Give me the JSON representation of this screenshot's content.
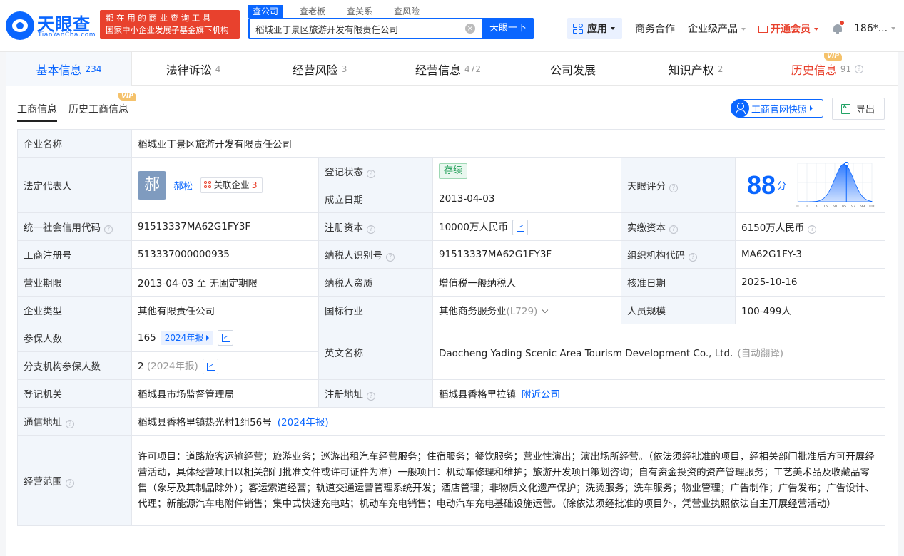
{
  "header": {
    "logo_cn": "天眼查",
    "logo_en": "TianYanCha.com",
    "banner_line1": "都在用的商业查询工具",
    "banner_line2": "国家中小企业发展子基金旗下机构",
    "search_tabs": [
      "查公司",
      "查老板",
      "查关系",
      "查风险"
    ],
    "search_value": "稻城亚丁景区旅游开发有限责任公司",
    "clear_glyph": "×",
    "search_button": "天眼一下",
    "apps_label": "应用",
    "business_coop": "商务合作",
    "enterprise_products": "企业级产品",
    "vip_label": "开通会员",
    "user": "186*..."
  },
  "tabs": [
    {
      "label": "基本信息",
      "count": "234"
    },
    {
      "label": "法律诉讼",
      "count": "4"
    },
    {
      "label": "经营风险",
      "count": "3"
    },
    {
      "label": "经营信息",
      "count": "472"
    },
    {
      "label": "公司发展",
      "count": ""
    },
    {
      "label": "知识产权",
      "count": "2"
    },
    {
      "label": "历史信息",
      "count": "91"
    }
  ],
  "vip_badge": "VIP",
  "subtabs": [
    "工商信息",
    "历史工商信息"
  ],
  "actions": {
    "gs_snapshot": "工商官网快照",
    "export": "导出"
  },
  "info": {
    "company_name_k": "企业名称",
    "company_name": "稻城亚丁景区旅游开发有限责任公司",
    "legal_rep_k": "法定代表人",
    "legal_rep_avatar": "郝",
    "legal_rep": "郝松",
    "related_label": "关联企业",
    "related_count": "3",
    "reg_status_k": "登记状态",
    "reg_status": "存续",
    "found_date_k": "成立日期",
    "found_date": "2013-04-03",
    "score_k": "天眼评分",
    "score": "88",
    "score_unit": "分",
    "uscc_k": "统一社会信用代码",
    "uscc": "91513337MA62G1FY3F",
    "reg_capital_k": "注册资本",
    "reg_capital": "10000万人民币",
    "paid_capital_k": "实缴资本",
    "paid_capital": "6150万人民币",
    "reg_no_k": "工商注册号",
    "reg_no": "513337000000935",
    "taxpayer_id_k": "纳税人识别号",
    "taxpayer_id": "91513337MA62G1FY3F",
    "org_code_k": "组织机构代码",
    "org_code": "MA62G1FY-3",
    "term_k": "营业期限",
    "term": "2013-04-03 至 无固定期限",
    "tax_qual_k": "纳税人资质",
    "tax_qual": "增值税一般纳税人",
    "approve_date_k": "核准日期",
    "approve_date": "2025-10-16",
    "ent_type_k": "企业类型",
    "ent_type": "其他有限责任公司",
    "industry_k": "国标行业",
    "industry": "其他商务服务业",
    "industry_code": "(L729)",
    "staff_k": "人员规模",
    "staff": "100-499人",
    "insured_k": "参保人数",
    "insured": "165",
    "insured_report": "2024年报",
    "branch_insured_k": "分支机构参保人数",
    "branch_insured": "2",
    "branch_insured_year": "(2024年报)",
    "en_name_k": "英文名称",
    "en_name": "Daocheng Yading Scenic Area Tourism Development Co., Ltd.",
    "auto_translate": "(自动翻译)",
    "reg_authority_k": "登记机关",
    "reg_authority": "稻城县市场监督管理局",
    "reg_address_k": "注册地址",
    "reg_address": "稻城县香格里拉镇",
    "nearby": "附近公司",
    "mail_address_k": "通信地址",
    "mail_address": "稻城县香格里镇热光村1组56号",
    "mail_address_year": "(2024年报)",
    "scope_k": "经营范围",
    "scope": "许可项目：道路旅客运输经营；旅游业务；巡游出租汽车经营服务；住宿服务；餐饮服务；营业性演出；演出场所经营。（依法须经批准的项目，经相关部门批准后方可开展经营活动，具体经营项目以相关部门批准文件或许可证件为准）一般项目：机动车修理和维护；旅游开发项目策划咨询；自有资金投资的资产管理服务；工艺美术品及收藏品零售（象牙及其制品除外）；客运索道经营；轨道交通运营管理系统开发；酒店管理；非物质文化遗产保护；洗烫服务；洗车服务；物业管理；广告制作；广告发布；广告设计、代理；新能源汽车电附件销售；集中式快速充电站；机动车充电销售；电动汽车充电基础设施运营。（除依法须经批准的项目外，凭营业执照依法自主开展经营活动）"
  },
  "score_chart": {
    "x_ticks": [
      "0",
      "1",
      "3",
      "15",
      "50",
      "85",
      "97",
      "99",
      "100"
    ],
    "marker_value": 88
  },
  "colors": {
    "brand": "#0a66ff",
    "alert": "#e8412d",
    "vip": "#f5c26b"
  }
}
